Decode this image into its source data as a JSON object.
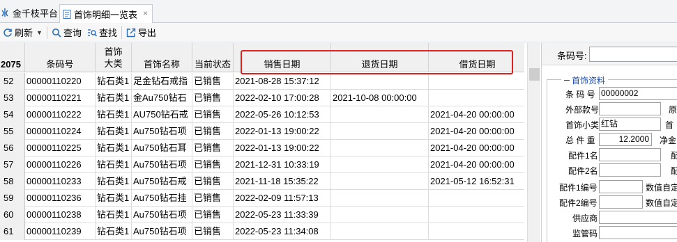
{
  "app": {
    "title": "金千枝平台"
  },
  "tab": {
    "label": "首饰明细一览表",
    "close": "×"
  },
  "toolbar": {
    "refresh_label": "刷新",
    "query_label": "查询",
    "find_label": "查找",
    "export_label": "导出"
  },
  "grid": {
    "row_count_header": "2075",
    "headers": [
      "条码号",
      "首饰\n大类",
      "首饰名称",
      "当前状态",
      "销售日期",
      "退货日期",
      "借货日期"
    ],
    "rows": [
      {
        "n": "52",
        "barcode": "00000110220",
        "cat": "钻石类1",
        "name": "足金钻石戒指",
        "status": "已销售",
        "sale": "2021-08-28 15:37:12",
        "return": "",
        "borrow": ""
      },
      {
        "n": "53",
        "barcode": "00000110221",
        "cat": "钻石类1",
        "name": "金Au750钻石",
        "status": "已销售",
        "sale": "2022-02-10 17:00:28",
        "return": "2021-10-08 00:00:00",
        "borrow": ""
      },
      {
        "n": "54",
        "barcode": "00000110222",
        "cat": "钻石类1",
        "name": "AU750钻石戒",
        "status": "已销售",
        "sale": "2022-05-26 10:12:53",
        "return": "",
        "borrow": "2021-04-20 00:00:00"
      },
      {
        "n": "55",
        "barcode": "00000110224",
        "cat": "钻石类1",
        "name": "Au750钻石项",
        "status": "已销售",
        "sale": "2022-01-13 19:00:22",
        "return": "",
        "borrow": "2021-04-20 00:00:00"
      },
      {
        "n": "56",
        "barcode": "00000110225",
        "cat": "钻石类1",
        "name": "Au750钻石耳",
        "status": "已销售",
        "sale": "2022-01-13 19:00:22",
        "return": "",
        "borrow": "2021-04-20 00:00:00"
      },
      {
        "n": "57",
        "barcode": "00000110226",
        "cat": "钻石类1",
        "name": "Au750钻石项",
        "status": "已销售",
        "sale": "2021-12-31 10:33:19",
        "return": "",
        "borrow": "2021-04-20 00:00:00"
      },
      {
        "n": "58",
        "barcode": "00000110233",
        "cat": "钻石类1",
        "name": "Au750钻石戒",
        "status": "已销售",
        "sale": "2021-11-18 15:35:22",
        "return": "",
        "borrow": "2021-05-12 16:52:31"
      },
      {
        "n": "59",
        "barcode": "00000110236",
        "cat": "钻石类1",
        "name": "Au750钻石挂",
        "status": "已销售",
        "sale": "2022-02-09 11:57:13",
        "return": "",
        "borrow": ""
      },
      {
        "n": "60",
        "barcode": "00000110238",
        "cat": "钻石类1",
        "name": "Au750钻石项",
        "status": "已销售",
        "sale": "2022-05-23 11:33:39",
        "return": "",
        "borrow": ""
      },
      {
        "n": "61",
        "barcode": "00000110239",
        "cat": "钻石类1",
        "name": "Au750钻石项",
        "status": "已销售",
        "sale": "2022-05-23 11:34:08",
        "return": "",
        "borrow": ""
      }
    ]
  },
  "panel": {
    "barcode_label": "条码号:",
    "barcode_value": "",
    "section_title": "首饰资料",
    "fields": {
      "barcode_label": "条 码 号",
      "barcode_value": "00000002",
      "external_label": "外部款号",
      "external_value": "",
      "orig_label": "原",
      "subtype_label": "首饰小类",
      "subtype_value": "红钻",
      "subtype_right_label": "首",
      "weight_label": "总 件 重",
      "weight_value": "12.2000",
      "net_label": "净金",
      "part1_label": "配件1名",
      "part1_right": "配",
      "part2_label": "配件2名",
      "part2_right": "配",
      "part1no_label": "配件1编号",
      "custom1_label": "数值自定",
      "part2no_label": "配件2编号",
      "custom2_label": "数值自定",
      "supplier_label": "供应商",
      "supervise_label": "监管码"
    }
  },
  "colors": {
    "highlight": "#e0211e",
    "legend": "#1f4fa8"
  }
}
